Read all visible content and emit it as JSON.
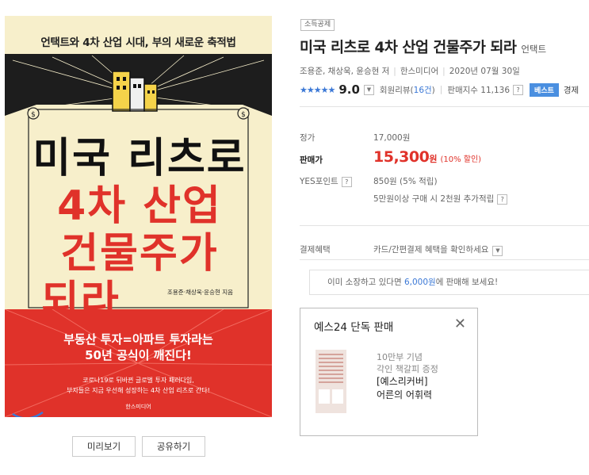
{
  "cover": {
    "tagline": "언택트와 4차 산업 시대, 부의 새로운 축적법",
    "title_lines": [
      "미국 리츠로",
      "4차 산업",
      "건물주가",
      "되라__"
    ],
    "authors": "조용준·채상욱·윤승현 지음",
    "band_headline_1": "부동산 투자=아파트 투자라는",
    "band_headline_2": "50년 공식이 깨진다!",
    "band_sub_1": "코로나19로 뒤바뀐 글로벌 투자 패러다임,",
    "band_sub_2": "부자들은 지금 우선해 성장하는 4차 산업 리츠로 간다!",
    "publisher": "한스미디어",
    "colors": {
      "cream": "#f7efcb",
      "red": "#e0322a"
    }
  },
  "cover_buttons": {
    "preview": "미리보기",
    "share": "공유하기"
  },
  "product": {
    "badge": "소득공제",
    "title": "미국 리츠로 4차 산업 건물주가 되라",
    "subtitle": "언택트",
    "authors": "조용준, 채상욱, 윤승현 저",
    "publisher": "한스미디어",
    "date": "2020년 07월 30일",
    "stars": "★★★★★",
    "score": "9.0",
    "review_label": "회원리뷰(",
    "review_count": "16건",
    "review_close": ")",
    "sales_index": "판매지수 11,136",
    "best_badge": "베스트",
    "best_tail": "경제"
  },
  "pricing": {
    "list_label": "정가",
    "list_price": "17,000원",
    "sale_label": "판매가",
    "sale_price": "15,300",
    "sale_unit": "원",
    "discount": "(10% 할인)",
    "points_label": "YES포인트",
    "points_value": "850원 (5% 적립)",
    "points_extra": "5만원이상 구매 시 2천원 추가적립",
    "benefit_label": "결제혜택",
    "benefit_value": "카드/간편결제 혜택을 확인하세요"
  },
  "resell": {
    "pre": "이미 소장하고 있다면 ",
    "amount": "6,000원",
    "post": "에 판매해 보세요!"
  },
  "exclusive": {
    "title": "예스24 단독 판매",
    "line1": "10만부 기념",
    "line2": "각인 책갈피 증정",
    "line3": "[예스리커버]",
    "line4": "어른의 어휘력"
  },
  "help_mark": "?"
}
